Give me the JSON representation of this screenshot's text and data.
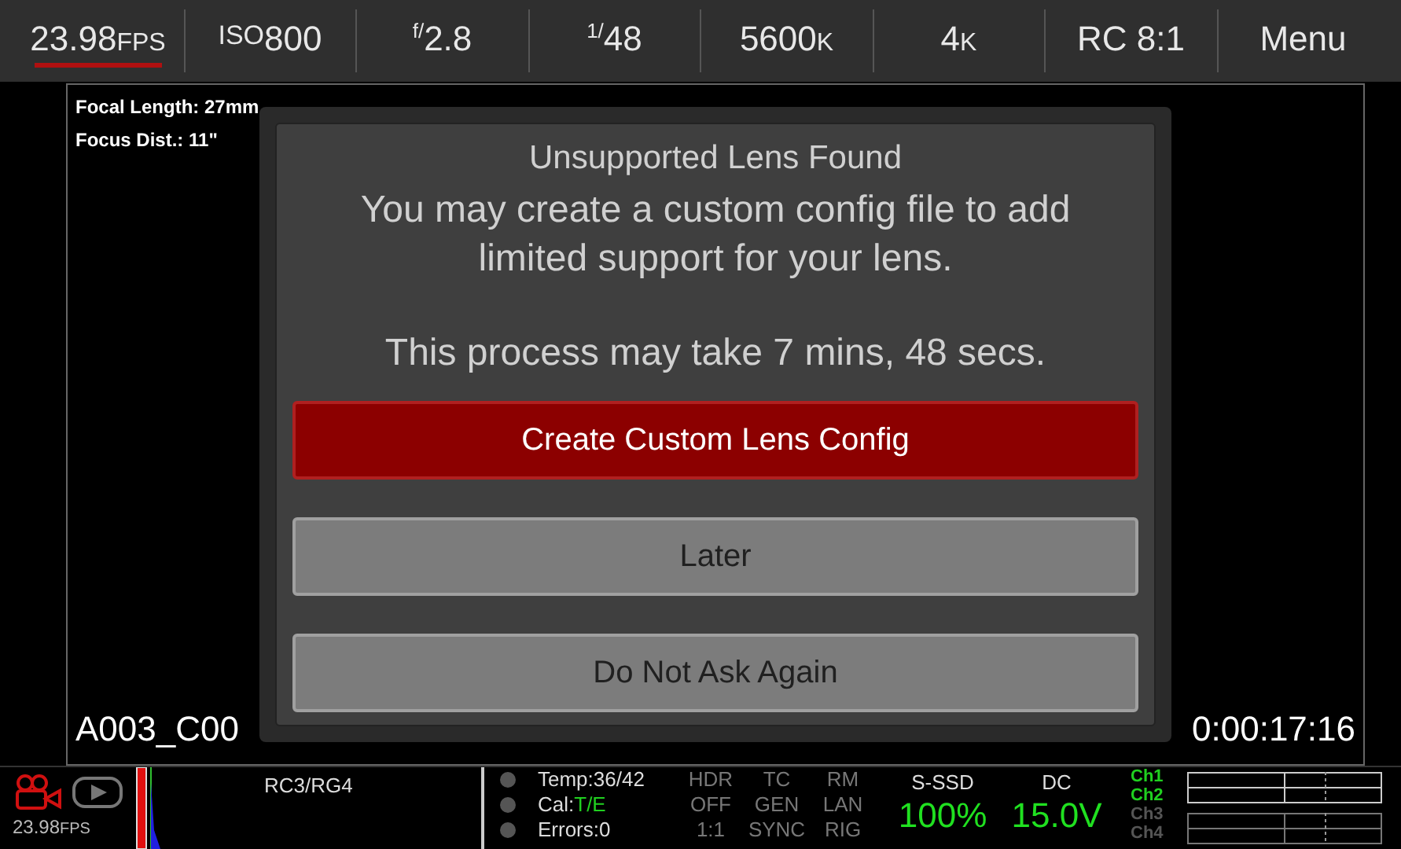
{
  "top_bar": [
    {
      "main": "23.98",
      "small_after": "FPS",
      "selected": true
    },
    {
      "small_before": "ISO",
      "main": "800",
      "selected": false
    },
    {
      "small_before": "f/",
      "main": "2.8",
      "selected": false
    },
    {
      "small_before": "1/",
      "main": "48",
      "selected": false
    },
    {
      "main": "5600",
      "small_after": "K",
      "selected": false
    },
    {
      "main": "4",
      "small_after": "K",
      "selected": false
    },
    {
      "main": "RC 8:1",
      "selected": false
    },
    {
      "main": "Menu",
      "selected": false
    }
  ],
  "viewport": {
    "focal_length": "Focal Length: 27mm",
    "focus_dist": "Focus Dist.: 11\"",
    "clip_name": "A003_C00",
    "timecode": "0:00:17:16"
  },
  "dialog": {
    "title": "Unsupported Lens Found",
    "message": "You may create a custom config file to add limited support for your lens.",
    "duration": "This process may take 7 mins, 48 secs.",
    "buttons": [
      {
        "label": "Create Custom Lens Config",
        "kind": "primary"
      },
      {
        "label": "Later",
        "kind": "secondary"
      },
      {
        "label": "Do Not Ask Again",
        "kind": "secondary"
      }
    ]
  },
  "bottom_bar": {
    "framerate_main": "23.98",
    "framerate_unit": "FPS",
    "look": "RC3/RG4",
    "status": [
      {
        "label": "Temp:36/42"
      },
      {
        "label": "Cal:",
        "value": "T/E"
      },
      {
        "label": "Errors:0"
      }
    ],
    "modes": [
      [
        "HDR",
        "OFF",
        "1:1"
      ],
      [
        "TC",
        "GEN",
        "SYNC"
      ],
      [
        "RM",
        "LAN",
        "RIG"
      ]
    ],
    "media": {
      "label": "S-SSD",
      "value": "100%"
    },
    "power": {
      "label": "DC",
      "value": "15.0V"
    },
    "channels": [
      {
        "label": "Ch1",
        "active": true
      },
      {
        "label": "Ch2",
        "active": true
      },
      {
        "label": "Ch3",
        "active": false
      },
      {
        "label": "Ch4",
        "active": false
      }
    ]
  }
}
